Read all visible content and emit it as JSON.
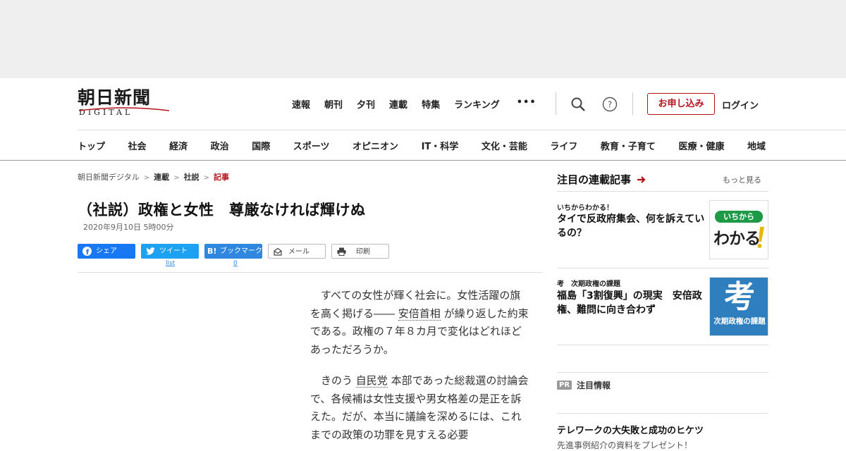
{
  "logo": {
    "kanji": "朝日新聞",
    "sub": "DIGITAL"
  },
  "topnav": {
    "items": [
      "速報",
      "朝刊",
      "夕刊",
      "連載",
      "特集",
      "ランキング"
    ],
    "more": "•••"
  },
  "header": {
    "apply_label": "お申し込み",
    "login_label": "ログイン"
  },
  "catnav": {
    "items": [
      "トップ",
      "社会",
      "経済",
      "政治",
      "国際",
      "スポーツ",
      "オピニオン",
      "IT・科学",
      "文化・芸能",
      "ライフ",
      "教育・子育て",
      "医療・健康",
      "地域"
    ]
  },
  "breadcrumb": {
    "items": [
      "朝日新聞デジタル",
      "連載",
      "社説"
    ],
    "current": "記事"
  },
  "article": {
    "title": "（社説）政権と女性　尊厳なければ輝けぬ",
    "date": "2020年9月10日 5時00分",
    "p1_a": "すべての女性が輝く社会に。女性活躍の旗を高く掲げる―― ",
    "p1_kw": "安倍首相",
    "p1_b": " が繰り返した約束である。政権の７年８カ月で変化はどれほどあっただろうか。",
    "p2_a": "きのう ",
    "p2_kw": "自民党",
    "p2_b": " 本部であった総裁選の討論会で、各候補は女性支援や男女格差の是正を訴えた。だが、本当に議論を深めるには、これまでの政策の功罪を見すえる必要"
  },
  "share": {
    "facebook": "シェア",
    "twitter": "ツイート",
    "hatena": "ブックマーク",
    "hatena_logo": "B!",
    "mail": "メール",
    "print": "印刷",
    "twitter_count": "list",
    "hatena_count": "0"
  },
  "sidebar": {
    "heading": "注目の連載記事",
    "more": "もっと見る",
    "items": [
      {
        "kicker": "いちからわかる！",
        "title": "タイで反政府集会、何を訴えているの？",
        "thumb_top": "いちから",
        "thumb_main": "わかる"
      },
      {
        "kicker": "考　次期政権の課題",
        "title": "福島「3割復興」の現実　安倍政権、難問に向き合わず",
        "thumb_char": "考",
        "thumb_caption": "次期政権の課題"
      }
    ],
    "pr_tag": "PR",
    "pr_label": "注目情報",
    "pr_title": "テレワークの大失敗と成功のヒケツ",
    "pr_sub": "先進事例紹介の資料をプレゼント！"
  },
  "colors": {
    "brand_red": "#b5121b",
    "facebook": "#1877f2",
    "twitter": "#1da1f2",
    "hatena": "#2f87e0"
  }
}
